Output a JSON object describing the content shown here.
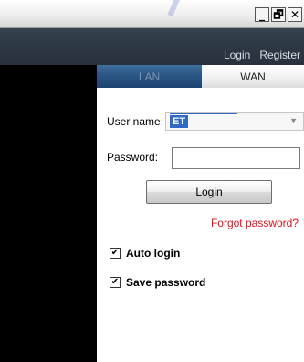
{
  "window": {
    "controls": {
      "minimize": "_",
      "restore": "🗗",
      "close": "✕"
    }
  },
  "header": {
    "links": {
      "login": "Login",
      "register": "Register"
    }
  },
  "tabs": [
    {
      "label": "LAN",
      "active": false
    },
    {
      "label": "WAN",
      "active": true
    }
  ],
  "form": {
    "username_label": "User name:",
    "username_value": "ET",
    "password_label": "Password:",
    "password_value": "",
    "login_button": "Login",
    "forgot_password": "Forgot password?",
    "auto_login": {
      "label": "Auto login",
      "checked": true
    },
    "save_password": {
      "label": "Save password",
      "checked": true
    }
  },
  "colors": {
    "header_bg": "#2e3845",
    "lan_tab_bg": "#2a5584",
    "forgot_link": "#e0101c",
    "selection": "#316ac5"
  },
  "icons": {
    "dropdown": "chevron-down-icon",
    "checkmark": "check-icon"
  }
}
